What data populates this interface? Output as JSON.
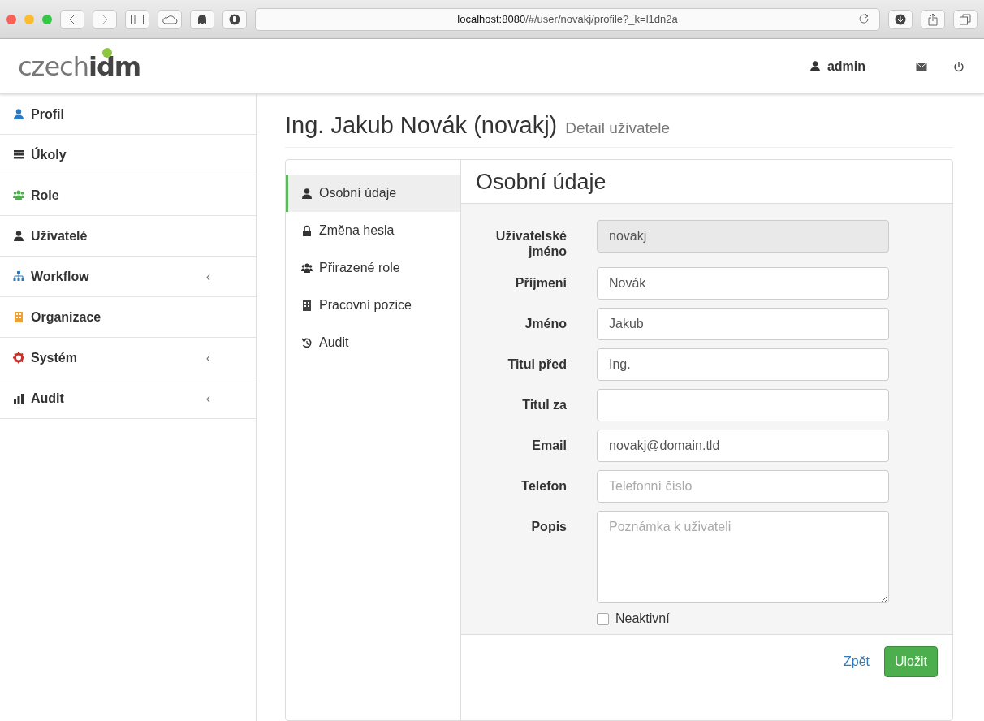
{
  "browser": {
    "url": "**localhost:8080**/#/user/novakj/profile?_k=l1dn2a"
  },
  "header": {
    "logo_prefix": "czech",
    "logo_suffix": "idm",
    "user": "admin"
  },
  "sidebar": {
    "items": [
      {
        "label": "Profil"
      },
      {
        "label": "Úkoly"
      },
      {
        "label": "Role"
      },
      {
        "label": "Uživatelé"
      },
      {
        "label": "Workflow",
        "chevron": "‹"
      },
      {
        "label": "Organizace"
      },
      {
        "label": "Systém",
        "chevron": "‹"
      },
      {
        "label": "Audit",
        "chevron": "‹"
      }
    ]
  },
  "page": {
    "title": "Ing. Jakub Novák (novakj)",
    "subtitle": "Detail uživatele"
  },
  "tabs": [
    {
      "label": "Osobní údaje",
      "selected": true
    },
    {
      "label": "Změna hesla",
      "selected": false
    },
    {
      "label": "Přirazené role",
      "selected": false
    },
    {
      "label": "Pracovní pozice",
      "selected": false
    },
    {
      "label": "Audit",
      "selected": false
    }
  ],
  "form": {
    "title": "Osobní údaje",
    "fields": [
      {
        "kind": "text",
        "label": "Uživatelské jméno",
        "value": "novakj",
        "disabled": true
      },
      {
        "kind": "text",
        "label": "Příjmení",
        "value": "Novák",
        "disabled": false
      },
      {
        "kind": "text",
        "label": "Jméno",
        "value": "Jakub",
        "disabled": false
      },
      {
        "kind": "text",
        "label": "Titul před",
        "value": "Ing.",
        "disabled": false
      },
      {
        "kind": "text",
        "label": "Titul za",
        "disabled": false
      },
      {
        "kind": "text",
        "label": "Email",
        "value": "novakj@domain.tld",
        "disabled": false
      },
      {
        "kind": "text",
        "label": "Telefon",
        "placeholder": "Telefonní číslo",
        "disabled": false
      },
      {
        "kind": "textarea",
        "label": "Popis",
        "placeholder": "Poznámka k uživateli",
        "disabled": false
      }
    ],
    "checkbox": {
      "label": "Neaktivní",
      "checked": false
    },
    "buttons": [
      {
        "kind": "link",
        "label": "Zpět"
      },
      {
        "kind": "primary",
        "label": "Uložit"
      }
    ]
  }
}
